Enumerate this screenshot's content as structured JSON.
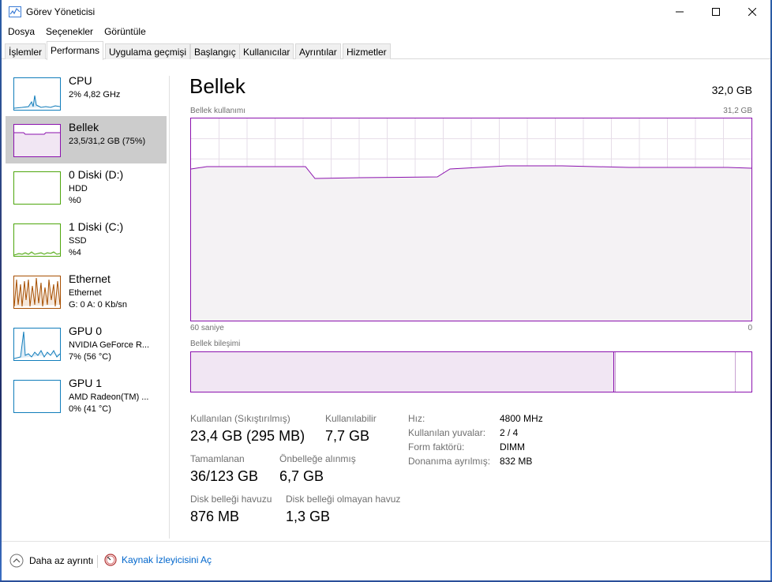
{
  "window": {
    "title": "Görev Yöneticisi"
  },
  "menu": [
    "Dosya",
    "Seçenekler",
    "Görüntüle"
  ],
  "tabs": [
    "İşlemler",
    "Performans",
    "Uygulama geçmişi",
    "Başlangıç",
    "Kullanıcılar",
    "Ayrıntılar",
    "Hizmetler"
  ],
  "active_tab": "Performans",
  "sidebar": [
    {
      "name": "CPU",
      "sub1": "2% 4,82 GHz",
      "sub2": "",
      "color": "#117dbb",
      "icon": "cpu-graph-icon"
    },
    {
      "name": "Bellek",
      "sub1": "23,5/31,2 GB (75%)",
      "sub2": "",
      "color": "#8b12ae",
      "icon": "memory-graph-icon"
    },
    {
      "name": "0 Diski (D:)",
      "sub1": "HDD",
      "sub2": "%0",
      "color": "#4da60c",
      "icon": "disk-graph-icon"
    },
    {
      "name": "1 Diski (C:)",
      "sub1": "SSD",
      "sub2": "%4",
      "color": "#4da60c",
      "icon": "disk-graph-icon"
    },
    {
      "name": "Ethernet",
      "sub1": "Ethernet",
      "sub2": "G: 0 A: 0 Kb/sn",
      "color": "#a74f01",
      "icon": "network-graph-icon"
    },
    {
      "name": "GPU 0",
      "sub1": "NVIDIA GeForce R...",
      "sub2": "7% (56 °C)",
      "color": "#117dbb",
      "icon": "gpu-graph-icon"
    },
    {
      "name": "GPU 1",
      "sub1": "AMD Radeon(TM) ...",
      "sub2": "0% (41 °C)",
      "color": "#117dbb",
      "icon": "gpu-graph-icon"
    }
  ],
  "selected_sidebar": "Bellek",
  "main": {
    "title": "Bellek",
    "total": "32,0 GB",
    "usage_label": "Bellek kullanımı",
    "usage_max": "31,2 GB",
    "x_left": "60 saniye",
    "x_right": "0",
    "composition_label": "Bellek bileşimi",
    "stats": [
      {
        "label": "Kullanılan (Sıkıştırılmış)",
        "value": "23,4 GB (295 MB)"
      },
      {
        "label": "Kullanılabilir",
        "value": "7,7 GB"
      },
      {
        "label": "Tamamlanan",
        "value": "36/123 GB"
      },
      {
        "label": "Önbelleğe alınmış",
        "value": "6,7 GB"
      },
      {
        "label": "Disk belleği havuzu",
        "value": "876 MB"
      },
      {
        "label": "Disk belleği olmayan havuz",
        "value": "1,3 GB"
      }
    ],
    "details": [
      {
        "label": "Hız:",
        "value": "4800 MHz"
      },
      {
        "label": "Kullanılan yuvalar:",
        "value": "2 / 4"
      },
      {
        "label": "Form faktörü:",
        "value": "DIMM"
      },
      {
        "label": "Donanıma ayrılmış:",
        "value": "832 MB"
      }
    ]
  },
  "footer": {
    "fewer_details": "Daha az ayrıntı",
    "resource_monitor": "Kaynak İzleyicisini Aç"
  },
  "colors": {
    "memory": "#8b12ae",
    "memory_fill": "#f4f2f4",
    "grid": "#e0d6e2"
  }
}
